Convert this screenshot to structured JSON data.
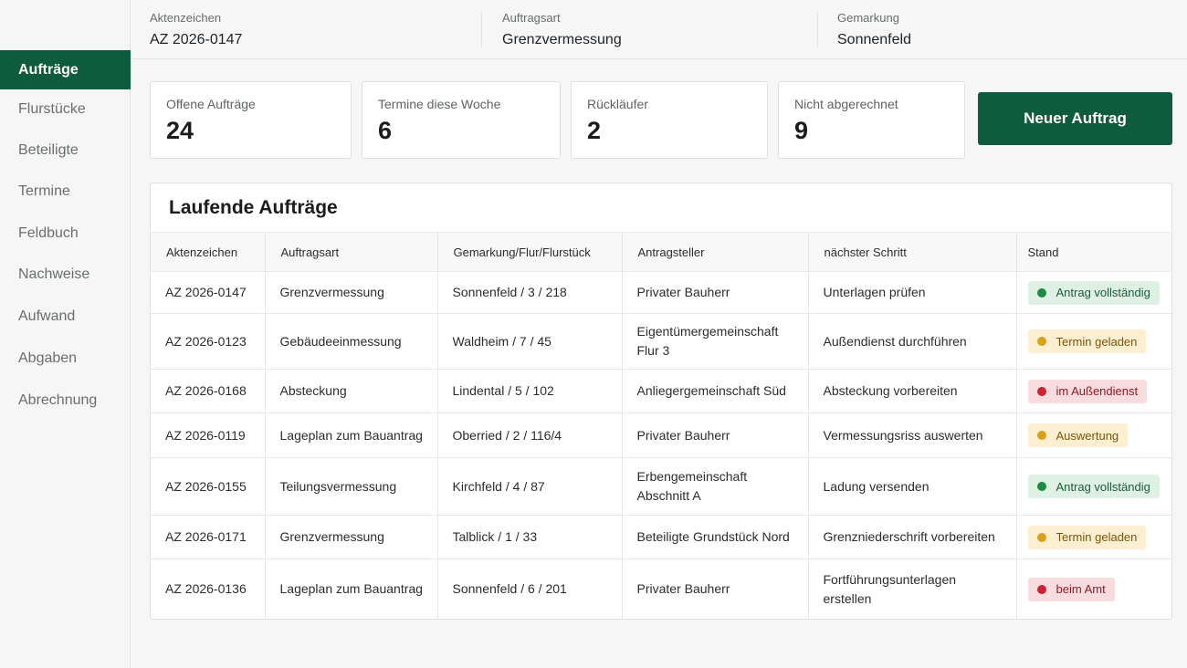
{
  "sidebar": {
    "items": [
      {
        "label": "Aufträge"
      },
      {
        "label": "Flurstücke"
      },
      {
        "label": "Beteiligte"
      },
      {
        "label": "Termine"
      },
      {
        "label": "Feldbuch"
      },
      {
        "label": "Nachweise"
      },
      {
        "label": "Aufwand"
      },
      {
        "label": "Abgaben"
      },
      {
        "label": "Abrechnung"
      }
    ]
  },
  "header": {
    "aktenzeichen_label": "Aktenzeichen",
    "aktenzeichen_value": "AZ 2026-0147",
    "auftragsart_label": "Auftragsart",
    "auftragsart_value": "Grenzvermessung",
    "gemarkung_label": "Gemarkung",
    "gemarkung_value": "Sonnenfeld"
  },
  "stats": [
    {
      "label": "Offene Aufträge",
      "value": "24"
    },
    {
      "label": "Termine diese Woche",
      "value": "6"
    },
    {
      "label": "Rückläufer",
      "value": "2"
    },
    {
      "label": "Nicht abgerechnet",
      "value": "9"
    }
  ],
  "new_button_label": "Neuer Auftrag",
  "table": {
    "title": "Laufende Aufträge",
    "columns": [
      "Aktenzeichen",
      "Auftragsart",
      "Gemarkung/Flur/Flurstück",
      "Antragsteller",
      "nächster Schritt",
      "Stand"
    ],
    "rows": [
      {
        "az": "AZ 2026-0147",
        "art": "Grenzvermessung",
        "gfl": "Sonnenfeld / 3 / 218",
        "antrag": "Privater Bauherr",
        "schritt": "Unterlagen prüfen",
        "stand": "Antrag vollständig"
      },
      {
        "az": "AZ 2026-0123",
        "art": "Gebäudeeinmessung",
        "gfl": "Waldheim / 7 / 45",
        "antrag": "Eigentümergemeinschaft Flur 3",
        "schritt": "Außendienst durchführen",
        "stand": "Termin geladen"
      },
      {
        "az": "AZ 2026-0168",
        "art": "Absteckung",
        "gfl": "Lindental / 5 / 102",
        "antrag": "Anliegergemeinschaft Süd",
        "schritt": "Absteckung vorbereiten",
        "stand": "im Außendienst"
      },
      {
        "az": "AZ 2026-0119",
        "art": "Lageplan zum Bauantrag",
        "gfl": "Oberried / 2 / 116/4",
        "antrag": "Privater Bauherr",
        "schritt": "Vermessungsriss auswerten",
        "stand": "Auswertung"
      },
      {
        "az": "AZ 2026-0155",
        "art": "Teilungsvermessung",
        "gfl": "Kirchfeld / 4 / 87",
        "antrag": "Erbengemeinschaft Abschnitt A",
        "schritt": "Ladung versenden",
        "stand": "Antrag vollständig"
      },
      {
        "az": "AZ 2026-0171",
        "art": "Grenzvermessung",
        "gfl": "Talblick / 1 / 33",
        "antrag": "Beteiligte Grundstück Nord",
        "schritt": "Grenzniederschrift vorbereiten",
        "stand": "Termin geladen"
      },
      {
        "az": "AZ 2026-0136",
        "art": "Lageplan zum Bauantrag",
        "gfl": "Sonnenfeld / 6 / 201",
        "antrag": "Privater Bauherr",
        "schritt": "Fortführungsunterlagen erstellen",
        "stand": "beim Amt"
      }
    ]
  },
  "status_colors": {
    "green": "#1e8a46",
    "yellow": "#d9a01c",
    "red": "#cc2231"
  }
}
